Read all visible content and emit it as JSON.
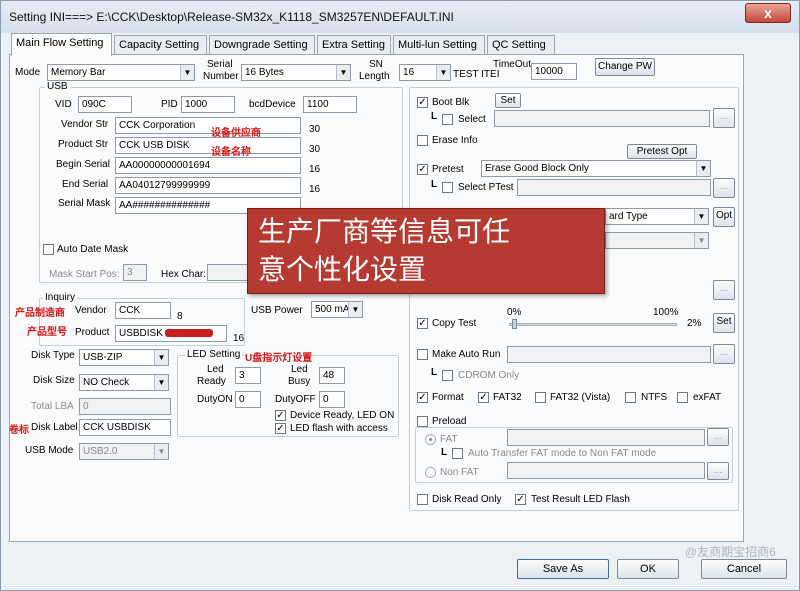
{
  "window": {
    "title": "Setting  INI===> E:\\CCK\\Desktop\\Release-SM32x_K1118_SM3257EN\\DEFAULT.INI",
    "close_symbol": "x"
  },
  "tabs": [
    "Main Flow Setting",
    "Capacity Setting",
    "Downgrade Setting",
    "Extra Setting",
    "Multi-lun Setting",
    "QC Setting"
  ],
  "top": {
    "mode_label": "Mode",
    "mode_value": "Memory Bar",
    "serial_label_1": "Serial",
    "serial_label_2": "Number",
    "serial_value": "16 Bytes",
    "sn_label_1": "SN",
    "sn_label_2": "Length",
    "sn_value": "16",
    "test_item_label": "TEST ITEI",
    "timeout_label": "TimeOut",
    "timeout_value": "10000",
    "change_pw": "Change PW"
  },
  "usb": {
    "group_label": "USB",
    "vid_label": "VID",
    "vid_value": "090C",
    "pid_label": "PID",
    "pid_value": "1000",
    "bcd_label": "bcdDevice",
    "bcd_value": "1100",
    "vendor_str_label": "Vendor Str",
    "vendor_str_value": "CCK Corporation",
    "vendor_str_len": "30",
    "vendor_str_note": "设备供应商",
    "product_str_label": "Product Str",
    "product_str_value": "CCK USB DISK",
    "product_str_len": "30",
    "product_str_note": "设备名称",
    "begin_serial_label": "Begin Serial",
    "begin_serial_value": "AA00000000001694",
    "begin_serial_len": "16",
    "end_serial_label": "End Serial",
    "end_serial_value": "AA04012799999999",
    "end_serial_len": "16",
    "serial_mask_label": "Serial Mask",
    "serial_mask_value": "AA##############",
    "auto_date_mask": "Auto Date Mask",
    "mask_start_pos_label": "Mask Start Pos:",
    "mask_start_pos_value": "3",
    "hex_char_label": "Hex Char:"
  },
  "inquiry": {
    "group_label": "Inquiry",
    "vendor_note": "产品制造商",
    "vendor_label": "Vendor",
    "vendor_value": "CCK",
    "vendor_len": "8",
    "product_note": "产品型号",
    "product_label": "Product",
    "product_value": "USBDISK",
    "product_len": "16"
  },
  "usb_power": {
    "label": "USB Power",
    "value": "500 mA"
  },
  "disk": {
    "type_label": "Disk Type",
    "type_value": "USB-ZIP",
    "size_label": "Disk Size",
    "size_value": "NO Check",
    "total_lba_label": "Total LBA",
    "total_lba_value": "0",
    "label_note": "卷标",
    "label_label": "Disk Label",
    "label_value": "CCK USBDISK",
    "usb_mode_label": "USB Mode",
    "usb_mode_value": "USB2.0"
  },
  "led": {
    "group_label": "LED Setting",
    "group_note": "U盘指示灯设置",
    "ready_label_1": "Led",
    "ready_label_2": "Ready",
    "ready_value": "3",
    "busy_label_1": "Led",
    "busy_label_2": "Busy",
    "busy_value": "48",
    "dutyon_label": "DutyON",
    "dutyon_value": "0",
    "dutyoff_label": "DutyOFF",
    "dutyoff_value": "0",
    "device_ready": "Device Ready, LED ON",
    "led_flash": "LED flash with access"
  },
  "right": {
    "boot_blk": "Boot Blk",
    "set_label": "Set",
    "select_label": "Select",
    "erase_info": "Erase Info",
    "pretest_opt": "Pretest Opt",
    "pretest": "Pretest",
    "pretest_value": "Erase Good Block Only",
    "select_ptest": "Select PTest",
    "ard_type": "ard Type",
    "opt_label": "Opt",
    "copy_test": "Copy Test",
    "pct_0": "0%",
    "pct_100": "100%",
    "pct_value": "2%",
    "copy_set": "Set",
    "copy_progress": 0.02,
    "make_auto_run": "Make Auto Run",
    "cdrom_only": "CDROM Only",
    "format": "Format",
    "fat32": "FAT32",
    "fat32_vista": "FAT32 (Vista)",
    "ntfs": "NTFS",
    "exfat": "exFAT",
    "preload": "Preload",
    "fat": "FAT",
    "auto_transfer": "Auto Transfer FAT mode to Non FAT mode",
    "non_fat": "Non FAT",
    "disk_read_only": "Disk Read Only",
    "test_result_led": "Test Result LED Flash",
    "browse": "..."
  },
  "overlay": {
    "line1": "生产厂商等信息可任",
    "line2": "意个性化设置"
  },
  "footer": {
    "save_as": "Save As",
    "ok": "OK",
    "cancel": "Cancel"
  },
  "watermark": "@友商期宝招商6"
}
